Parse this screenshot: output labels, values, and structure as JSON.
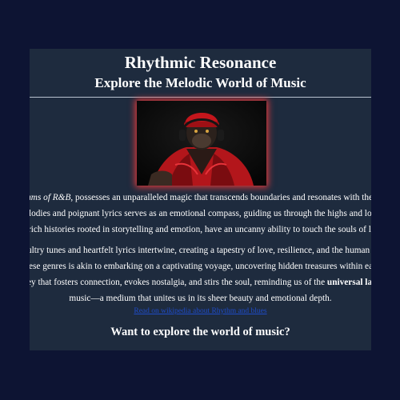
{
  "header": {
    "title": "Rhythmic Resonance",
    "subtitle": "Explore the Melodic World of Music"
  },
  "image": {
    "description_icon": "gorilla-with-headphones-image"
  },
  "body": {
    "lines": [
      {
        "pre_italic": "thms of R&B",
        "text": ", possesses an unparalleled magic that transcends boundaries and resonates with the de"
      },
      {
        "text": "lodies and poignant lyrics serves as an emotional compass, guiding us through the highs and lows o"
      },
      {
        "text": "rich histories rooted in storytelling and emotion, have an uncanny ability to touch the souls of liste"
      },
      {
        "text": "ultry tunes and heartfelt lyrics intertwine, creating a tapestry of love, resilience, and the human expe"
      },
      {
        "text": "ese genres is akin to embarking on a captivating voyage, uncovering hidden treasures within each n"
      },
      {
        "text": "ey that fosters connection, evokes nostalgia, and stirs the soul, reminding us of the ",
        "bold": "universal langu"
      },
      {
        "text": "music—a medium that unites us in its sheer beauty and emotional depth."
      }
    ]
  },
  "link": {
    "label": "Read on wikipedia about Rhythm and blues"
  },
  "cta": {
    "text": "Want to explore the world of music?"
  },
  "colors": {
    "background": "#0d1433",
    "panel": "#1e2b3e",
    "link": "#1f4cc9",
    "image_glow": "#e23a3a"
  }
}
